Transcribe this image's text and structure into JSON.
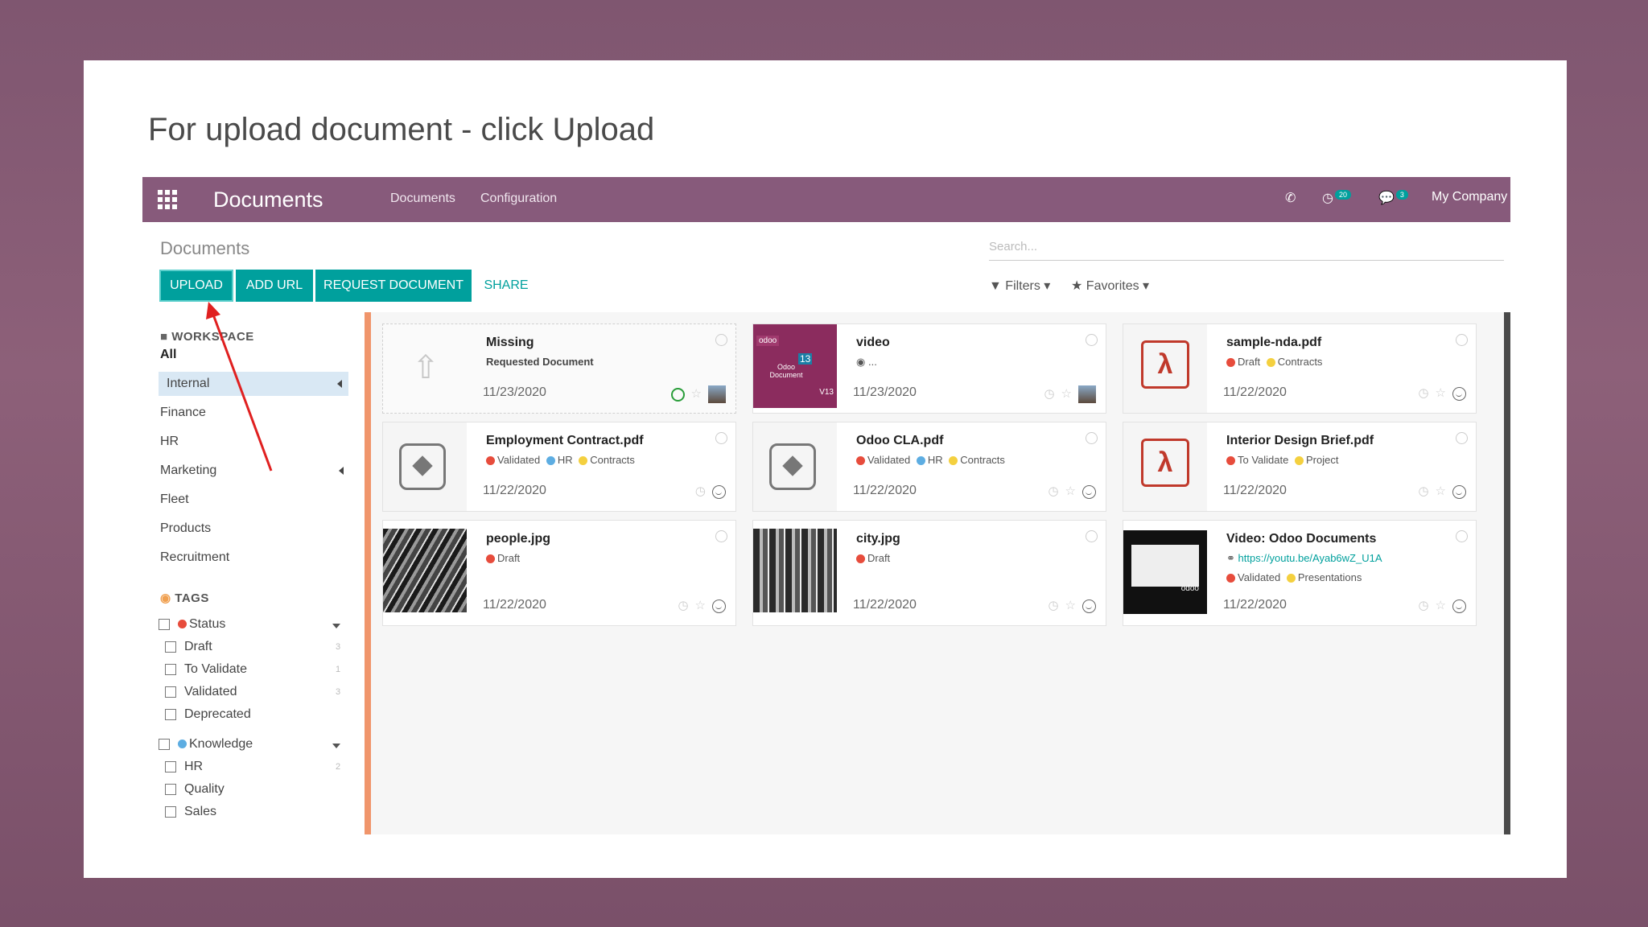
{
  "caption": "For upload document - click Upload",
  "navbar": {
    "brand": "Documents",
    "menu": [
      "Documents",
      "Configuration"
    ],
    "activity_badge": "20",
    "messages_badge": "3",
    "company": "My Company"
  },
  "control_panel": {
    "title": "Documents",
    "search_placeholder": "Search...",
    "buttons": {
      "upload": "UPLOAD",
      "add_url": "ADD URL",
      "request": "REQUEST DOCUMENT",
      "share": "SHARE"
    },
    "filters": "Filters",
    "favorites": "Favorites"
  },
  "sidebar": {
    "workspace_header": "WORKSPACE",
    "workspaces": [
      "All",
      "Internal",
      "Finance",
      "HR",
      "Marketing",
      "Fleet",
      "Products",
      "Recruitment"
    ],
    "tags_header": "TAGS",
    "status": {
      "label": "Status",
      "color": "#e74c3c",
      "items": [
        {
          "label": "Draft",
          "count": "3"
        },
        {
          "label": "To Validate",
          "count": "1"
        },
        {
          "label": "Validated",
          "count": "3"
        },
        {
          "label": "Deprecated",
          "count": ""
        }
      ]
    },
    "knowledge": {
      "label": "Knowledge",
      "color": "#5dade2",
      "items": [
        {
          "label": "HR",
          "count": "2"
        },
        {
          "label": "Quality",
          "count": ""
        },
        {
          "label": "Sales",
          "count": ""
        }
      ]
    }
  },
  "cards": [
    {
      "title": "Missing",
      "subtitle": "Requested Document",
      "date": "11/23/2020"
    },
    {
      "title": "video",
      "subtitle": "...",
      "date": "11/23/2020",
      "thumb_text": "odoo",
      "thumb_sub": "Odoo Document",
      "thumb_ver": "V13",
      "thumb_num": "13"
    },
    {
      "title": "sample-nda.pdf",
      "tags": [
        "Draft",
        "Contracts"
      ],
      "date": "11/22/2020"
    },
    {
      "title": "Employment Contract.pdf",
      "tags": [
        "Validated",
        "HR",
        "Contracts"
      ],
      "date": "11/22/2020"
    },
    {
      "title": "Odoo CLA.pdf",
      "tags": [
        "Validated",
        "HR",
        "Contracts"
      ],
      "date": "11/22/2020"
    },
    {
      "title": "Interior Design Brief.pdf",
      "tags": [
        "To Validate",
        "Project"
      ],
      "date": "11/22/2020"
    },
    {
      "title": "people.jpg",
      "tags": [
        "Draft"
      ],
      "date": "11/22/2020"
    },
    {
      "title": "city.jpg",
      "tags": [
        "Draft"
      ],
      "date": "11/22/2020"
    },
    {
      "title": "Video: Odoo Documents",
      "url": "https://youtu.be/Ayab6wZ_U1A",
      "tags": [
        "Validated",
        "Presentations"
      ],
      "date": "11/22/2020",
      "thumb_text": "odoo"
    }
  ],
  "colors": {
    "brand": "#875a7b",
    "primary": "#00a09d",
    "tag_red": "#e74c3c",
    "tag_blue": "#5dade2",
    "tag_yellow": "#f4d03f",
    "arrow": "#e02020"
  }
}
